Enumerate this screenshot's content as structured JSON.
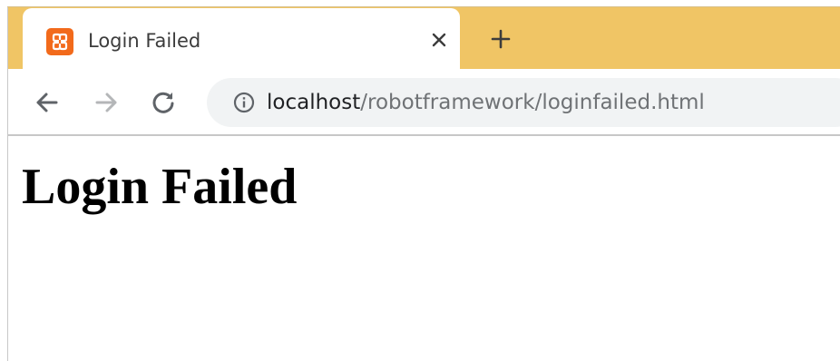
{
  "browser": {
    "tab": {
      "title": "Login Failed",
      "favicon": "xampp-icon",
      "close_icon": "close-icon"
    },
    "new_tab_icon": "plus-icon",
    "tabstrip_color": "#f0c565",
    "favicon_color": "#f26a1b",
    "nav": {
      "back_icon": "arrow-left-icon",
      "forward_icon": "arrow-right-icon",
      "reload_icon": "reload-icon"
    },
    "address_bar": {
      "info_icon": "info-icon",
      "url_host": "localhost",
      "url_path": "/robotframework/loginfailed.html"
    }
  },
  "page": {
    "heading": "Login Failed"
  }
}
